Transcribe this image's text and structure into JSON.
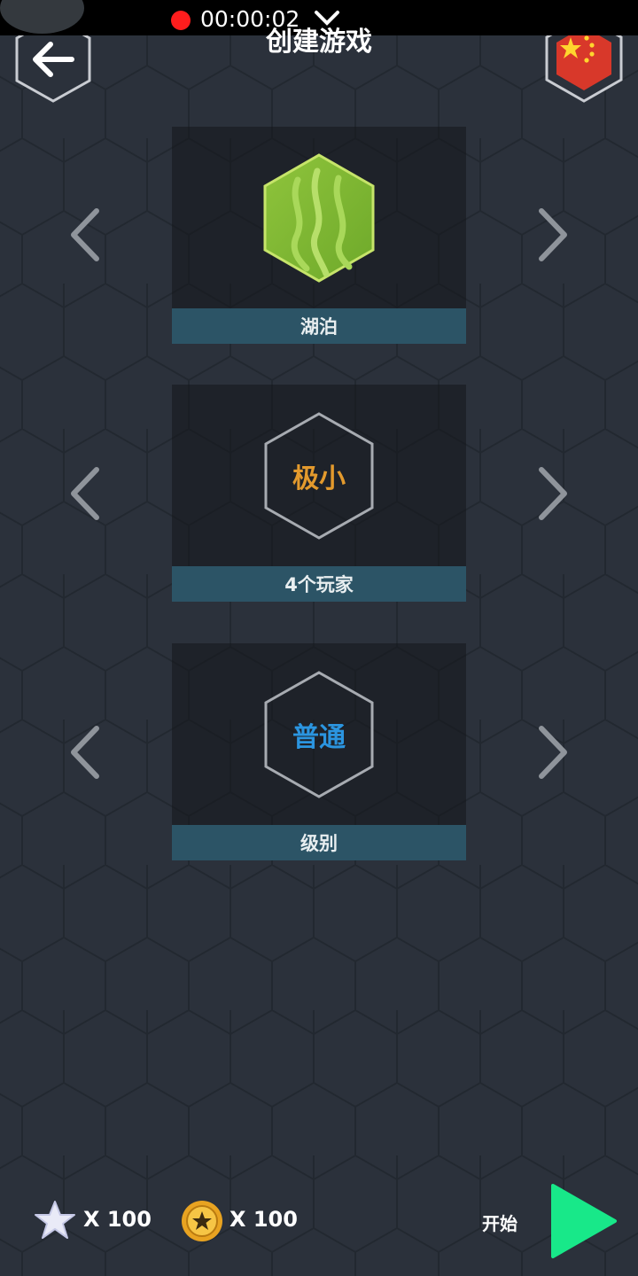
{
  "status_bar": {
    "recording_time": "00:00:02"
  },
  "header": {
    "title": "创建游戏",
    "back_icon": "arrow-left-icon",
    "language_flag_icon": "china-flag-icon"
  },
  "map_selector": {
    "label": "湖泊",
    "icon": "lake-map-icon",
    "prev_icon": "chevron-left-icon",
    "next_icon": "chevron-right-icon"
  },
  "size_selector": {
    "value": "极小",
    "label": "4个玩家",
    "value_color": "#e39a2d"
  },
  "level_selector": {
    "value": "普通",
    "label": "级别",
    "value_color": "#2b95e0"
  },
  "footer": {
    "stars": "X 100",
    "coins": "X 100",
    "start_label": "开始",
    "play_color": "#18e889"
  }
}
